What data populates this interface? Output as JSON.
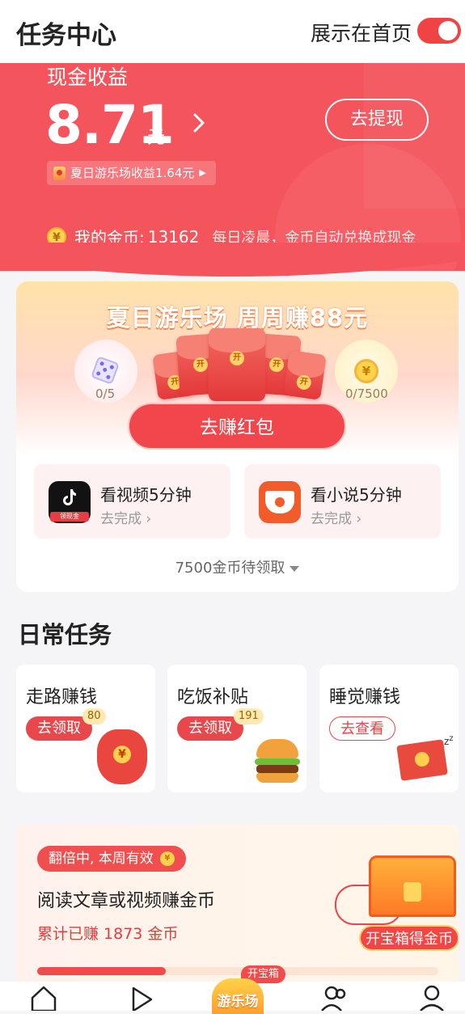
{
  "header": {
    "title": "任务中心",
    "show_on_home_label": "展示在首页",
    "show_on_home_enabled": true
  },
  "earnings": {
    "cash_label": "现金收益",
    "amount": "8.71",
    "unit": "元",
    "withdraw_label": "去提现",
    "summer_income": "夏日游乐场收益1.64元",
    "coin_label": "我的金币:",
    "coin_value": "13162",
    "coin_note": "每日凌晨，金币自动兑换成现金"
  },
  "summer": {
    "title": "夏日游乐场 周周赚88元",
    "left_count": "0/5",
    "right_count": "0/7500",
    "earn_button": "去赚红包",
    "env_seal": "开",
    "tasks": [
      {
        "title": "看视频5分钟",
        "sub": "去完成 ›",
        "icon": "tiktok-icon",
        "tag": "领现金"
      },
      {
        "title": "看小说5分钟",
        "sub": "去完成 ›",
        "icon": "novel-app-icon"
      }
    ],
    "pending": "7500金币待领取"
  },
  "daily": {
    "title": "日常任务",
    "cards": [
      {
        "title": "走路赚钱",
        "button": "去领取",
        "badge": "80",
        "style": "fill"
      },
      {
        "title": "吃饭补贴",
        "button": "去领取",
        "badge": "191",
        "style": "fill"
      },
      {
        "title": "睡觉赚钱",
        "button": "去查看",
        "badge": "",
        "style": "outline"
      }
    ]
  },
  "reading": {
    "badge": "翻倍中, 本周有效",
    "title": "阅读文章或视频赚金币",
    "total": "累计已赚 1873 金币",
    "chest_label": "开宝箱得金币",
    "progress": 0.32
  },
  "nav": {
    "center_label": "游乐场",
    "center_tag": "开宝箱",
    "items": [
      "home-icon",
      "play-icon",
      "amusement-park-icon",
      "friends-icon",
      "profile-icon"
    ]
  },
  "colors": {
    "accent": "#f04343",
    "banner": "#f4545b"
  }
}
